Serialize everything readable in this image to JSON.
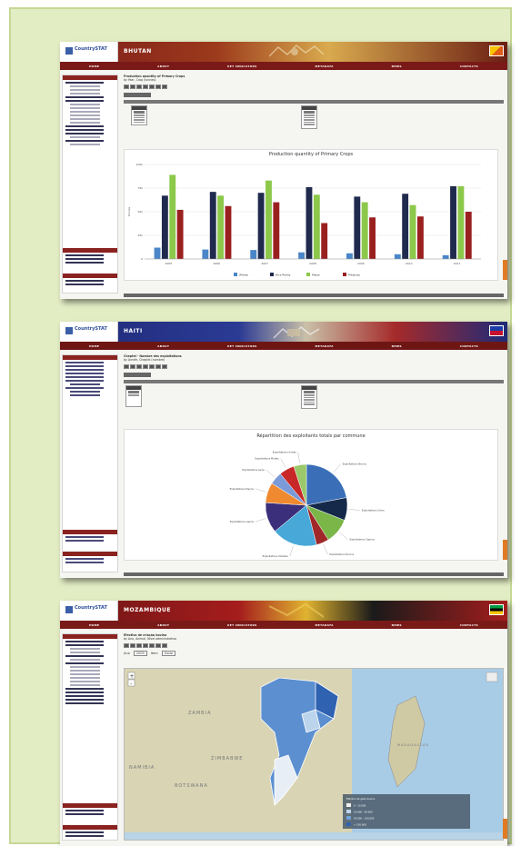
{
  "nav_items": [
    "HOME",
    "ABOUT",
    "KEY INDICATORS",
    "METADATA",
    "NEWS",
    "CONTACTS"
  ],
  "colors": {
    "page_bg": "#e3edc4",
    "nav": "#7a1a18",
    "orange_tab": "#e07a24"
  },
  "bhutan": {
    "logo": "CountrySTAT",
    "country": "BHUTAN",
    "page_title": "Production quantity of Primary Crops",
    "page_subtitle": "by Year, Crop (tonnes)",
    "chart_data": {
      "type": "bar",
      "title": "Production quantity of Primary Crops",
      "ylabel": "Tonnes",
      "ylim": [
        0,
        100000
      ],
      "yticks": [
        "0",
        "25k",
        "50k",
        "75k",
        "100k"
      ],
      "categories": [
        "2005",
        "2006",
        "2007",
        "2008",
        "2009",
        "2010",
        "2011"
      ],
      "series": [
        {
          "name": "Wheat",
          "color": "#4a86c8",
          "values": [
            12000,
            10000,
            9500,
            7000,
            6000,
            5000,
            4000
          ]
        },
        {
          "name": "Rice Paddy",
          "color": "#1f2a4e",
          "values": [
            67000,
            71000,
            70000,
            76000,
            66000,
            69000,
            77000
          ]
        },
        {
          "name": "Maize",
          "color": "#8cc84a",
          "values": [
            89000,
            67000,
            83000,
            68000,
            60000,
            57000,
            77000
          ]
        },
        {
          "name": "Potatoes",
          "color": "#9a2020",
          "values": [
            52000,
            56000,
            60000,
            38000,
            44000,
            45000,
            50000
          ]
        }
      ],
      "grid": true,
      "legend": "bottom"
    }
  },
  "haiti": {
    "logo": "CountrySTAT",
    "country": "HAITI",
    "page_title": "Cheptel - Nombre des exploitations",
    "page_subtitle": "by Année, Cheptel (nombre)",
    "chart_data": {
      "type": "pie",
      "title": "Répartition des exploitants totals par commune",
      "slices": [
        {
          "label": "Exploitations Bovins",
          "value": 22,
          "color": "#3a6fb8"
        },
        {
          "label": "Exploitations Ovins",
          "value": 9,
          "color": "#152a4a"
        },
        {
          "label": "Exploitations Caprins",
          "value": 10,
          "color": "#7ab648"
        },
        {
          "label": "Exploitations Porcins",
          "value": 5,
          "color": "#a02828"
        },
        {
          "label": "Exploitations Volailles",
          "value": 18,
          "color": "#48a8d8"
        },
        {
          "label": "Exploitations Lapins",
          "value": 12,
          "color": "#3b2e7a"
        },
        {
          "label": "Exploitations Equins",
          "value": 8,
          "color": "#f08a30"
        },
        {
          "label": "Exploitations Asins",
          "value": 5,
          "color": "#7a9ad8"
        },
        {
          "label": "Exploitations Mulets",
          "value": 6,
          "color": "#c82828"
        },
        {
          "label": "Exploitations Autres",
          "value": 5,
          "color": "#9ac86a"
        }
      ]
    }
  },
  "mozambique": {
    "logo": "CountrySTAT",
    "country": "MOZAMBIQUE",
    "page_title": "Efectivo de criação bovina",
    "page_subtitle": "by Ano, Animal, Nível administrativo",
    "year_label": "Ano",
    "year_value": "2009",
    "item_label": "Item",
    "item_value": "Gado",
    "map_labels": [
      "ZAMBIA",
      "ZIMBABWE",
      "BOTSWANA",
      "NAMIBIA",
      "MADAGASCAR"
    ],
    "legend_title": "Efectivo de gado bovino",
    "legend_items": [
      {
        "label": "0 - 10.000",
        "color": "#f0f0f0"
      },
      {
        "label": "10.000 - 50.000",
        "color": "#bcd4ec"
      },
      {
        "label": "50.000 - 150.000",
        "color": "#6fa0d8"
      },
      {
        "label": "> 150.000",
        "color": "#2f62b0"
      }
    ]
  }
}
